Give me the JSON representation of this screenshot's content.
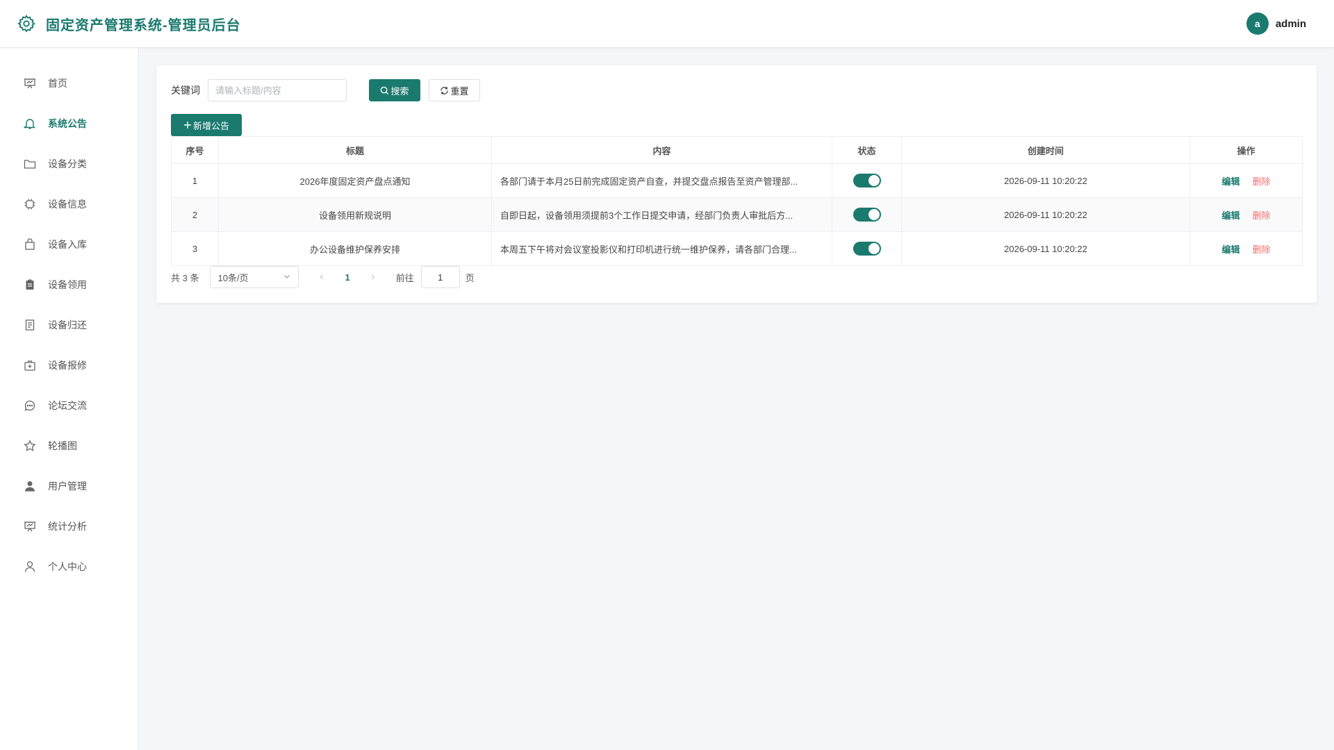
{
  "header": {
    "title": "固定资产管理系统-管理员后台",
    "avatar_letter": "a",
    "username": "admin",
    "logo_icon": "gear-icon",
    "accent_color": "#1a7a6e"
  },
  "sidebar": {
    "items": [
      {
        "label": "首页",
        "icon": "presentation-icon",
        "active": false
      },
      {
        "label": "系统公告",
        "icon": "bell-icon",
        "active": true
      },
      {
        "label": "设备分类",
        "icon": "folder-icon",
        "active": false
      },
      {
        "label": "设备信息",
        "icon": "chip-icon",
        "active": false
      },
      {
        "label": "设备入库",
        "icon": "bag-icon",
        "active": false
      },
      {
        "label": "设备领用",
        "icon": "clipboard-icon",
        "active": false
      },
      {
        "label": "设备归还",
        "icon": "document-icon",
        "active": false
      },
      {
        "label": "设备报修",
        "icon": "medical-box-icon",
        "active": false
      },
      {
        "label": "论坛交流",
        "icon": "chat-icon",
        "active": false
      },
      {
        "label": "轮播图",
        "icon": "star-icon",
        "active": false
      },
      {
        "label": "用户管理",
        "icon": "user-filled-icon",
        "active": false
      },
      {
        "label": "统计分析",
        "icon": "presentation-icon",
        "active": false
      },
      {
        "label": "个人中心",
        "icon": "user-icon",
        "active": false
      }
    ]
  },
  "search": {
    "label": "关键词",
    "placeholder": "请输入标题/内容",
    "value": "",
    "search_button": "搜索",
    "reset_button": "重置"
  },
  "add_button": "新增公告",
  "table": {
    "headers": [
      "序号",
      "标题",
      "内容",
      "状态",
      "创建时间",
      "操作"
    ],
    "rows": [
      {
        "index": "1",
        "title": "2026年度固定资产盘点通知",
        "content": "各部门请于本月25日前完成固定资产自查，并提交盘点报告至资产管理部...",
        "status": true,
        "created": "2026-09-11 10:20:22"
      },
      {
        "index": "2",
        "title": "设备领用新规说明",
        "content": "自即日起，设备领用须提前3个工作日提交申请，经部门负责人审批后方...",
        "status": true,
        "created": "2026-09-11 10:20:22"
      },
      {
        "index": "3",
        "title": "办公设备维护保养安排",
        "content": "本周五下午将对会议室投影仪和打印机进行统一维护保养，请各部门合理...",
        "status": true,
        "created": "2026-09-11 10:20:22"
      }
    ],
    "edit_label": "编辑",
    "delete_label": "删除"
  },
  "pagination": {
    "total_text": "共 3 条",
    "page_size": "10条/页",
    "current_page": "1",
    "goto_label": "前往",
    "goto_value": "1",
    "page_unit": "页"
  }
}
